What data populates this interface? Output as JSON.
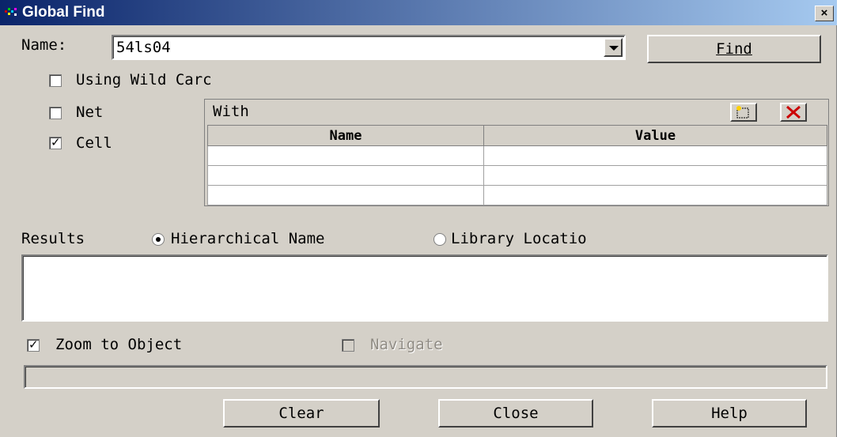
{
  "window": {
    "title": "Global Find",
    "close_label": "×"
  },
  "name_field": {
    "label": "Name:",
    "value": "54ls04"
  },
  "find_button": {
    "label": "Find"
  },
  "options": {
    "wildcard_label": "Using Wild Carc",
    "wildcard_checked": false,
    "net_label": "Net",
    "net_checked": false,
    "cell_label": "Cell",
    "cell_checked": true
  },
  "with_panel": {
    "header": "With",
    "columns": [
      "Name",
      "Value"
    ],
    "rows": [
      [
        "",
        ""
      ],
      [
        "",
        ""
      ],
      [
        "",
        ""
      ]
    ]
  },
  "results": {
    "label": "Results",
    "radio_hier_label": "Hierarchical Name",
    "radio_lib_label": "Library Locatio",
    "selected": "Hierarchical Name"
  },
  "zoom": {
    "label": "Zoom to Object",
    "checked": true
  },
  "navigate": {
    "label": "Navigate",
    "checked": false,
    "enabled": false
  },
  "buttons": {
    "clear": "Clear",
    "close": "Close",
    "help": "Help"
  },
  "colors": {
    "face": "#d4d0c8",
    "title_start": "#0a246a",
    "title_end": "#a6caf0",
    "delete_x": "#cc0000"
  }
}
